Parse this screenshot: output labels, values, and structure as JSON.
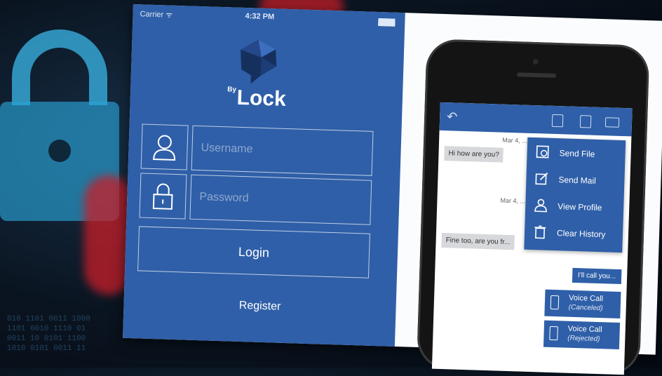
{
  "login": {
    "status": {
      "carrier": "Carrier ᯤ",
      "time": "4:32 PM"
    },
    "app_name": "Lock",
    "app_name_prefix": "By",
    "username_placeholder": "Username",
    "password_placeholder": "Password",
    "login_label": "Login",
    "register_label": "Register"
  },
  "chat": {
    "date_1": "Mar 4, ...",
    "message_1": "Hi how are you?",
    "date_2": "Mar 4, ...",
    "message_2": "Fine too, are you fr...",
    "reply_1": "I'll call you...",
    "calls": [
      {
        "title": "Voice Call",
        "status": "(Canceled)"
      },
      {
        "title": "Voice Call",
        "status": "(Rejected)"
      }
    ],
    "menu": [
      {
        "label": "Send File",
        "icon": "file-icon"
      },
      {
        "label": "Send Mail",
        "icon": "pencil-icon"
      },
      {
        "label": "View Profile",
        "icon": "user-icon"
      },
      {
        "label": "Clear History",
        "icon": "trash-icon"
      }
    ]
  },
  "colors": {
    "brand_blue": "#2f5fa8",
    "bg_dark": "#0a1420",
    "accent_red": "#c81e28"
  }
}
